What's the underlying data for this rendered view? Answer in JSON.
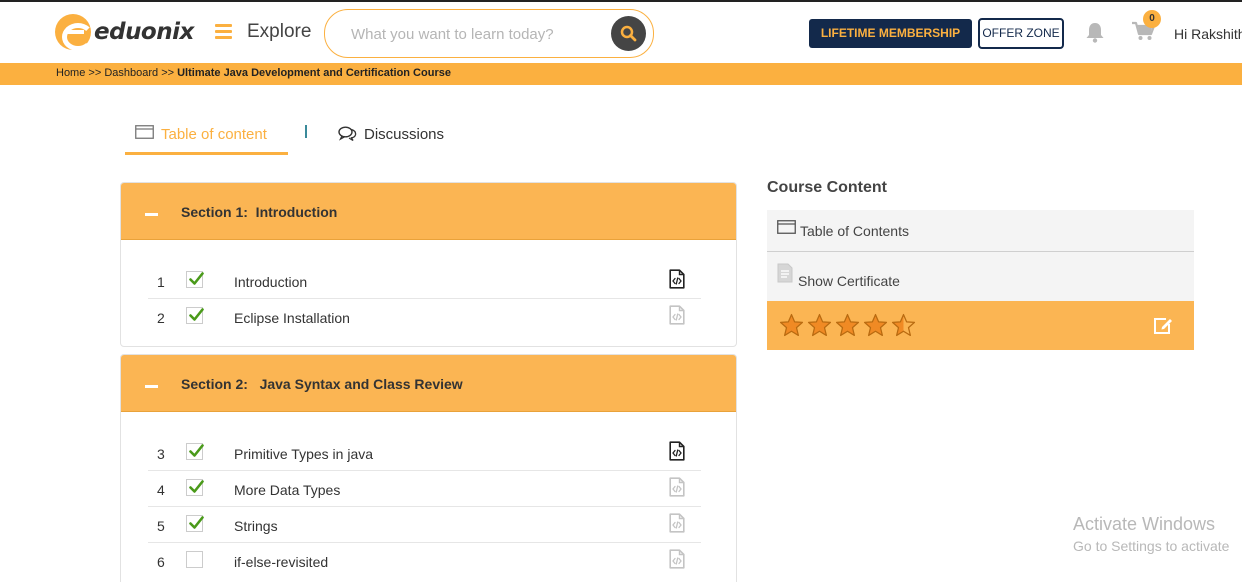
{
  "header": {
    "logo_text": "eduonix",
    "explore_label": "Explore",
    "search_placeholder": "What you want to learn today?",
    "lifetime_label": "LIFETIME MEMBERSHIP",
    "offer_label": "OFFER ZONE",
    "cart_count": "0",
    "greeting": "Hi Rakshith"
  },
  "breadcrumb": {
    "home": "Home",
    "sep1": " >> ",
    "dashboard": "Dashboard",
    "sep2": " >> ",
    "course": "Ultimate Java Development and Certification Course"
  },
  "tabs": {
    "toc_label": "Table of content",
    "discussions_label": "Discussions"
  },
  "sections": [
    {
      "title": "Section 1:  Introduction",
      "items": [
        {
          "num": "1",
          "label": "Introduction",
          "checked": true,
          "icon_active": true
        },
        {
          "num": "2",
          "label": "Eclipse Installation",
          "checked": true,
          "icon_active": false
        }
      ]
    },
    {
      "title": "Section 2:   Java Syntax and Class Review",
      "items": [
        {
          "num": "3",
          "label": "Primitive Types in java",
          "checked": true,
          "icon_active": true
        },
        {
          "num": "4",
          "label": "More Data Types",
          "checked": true,
          "icon_active": false
        },
        {
          "num": "5",
          "label": "Strings",
          "checked": true,
          "icon_active": false
        },
        {
          "num": "6",
          "label": "if-else-revisited",
          "checked": false,
          "icon_active": false
        }
      ]
    }
  ],
  "sidebar": {
    "title": "Course Content",
    "toc_label": "Table of Contents",
    "certificate_label": "Show Certificate",
    "rating": 4.5,
    "rating_max": 5
  },
  "watermark": {
    "line1": "Activate Windows",
    "line2": "Go to Settings to activate"
  },
  "colors": {
    "accent": "#fbb040",
    "navy": "#13294b",
    "check": "#4a9a1a"
  }
}
